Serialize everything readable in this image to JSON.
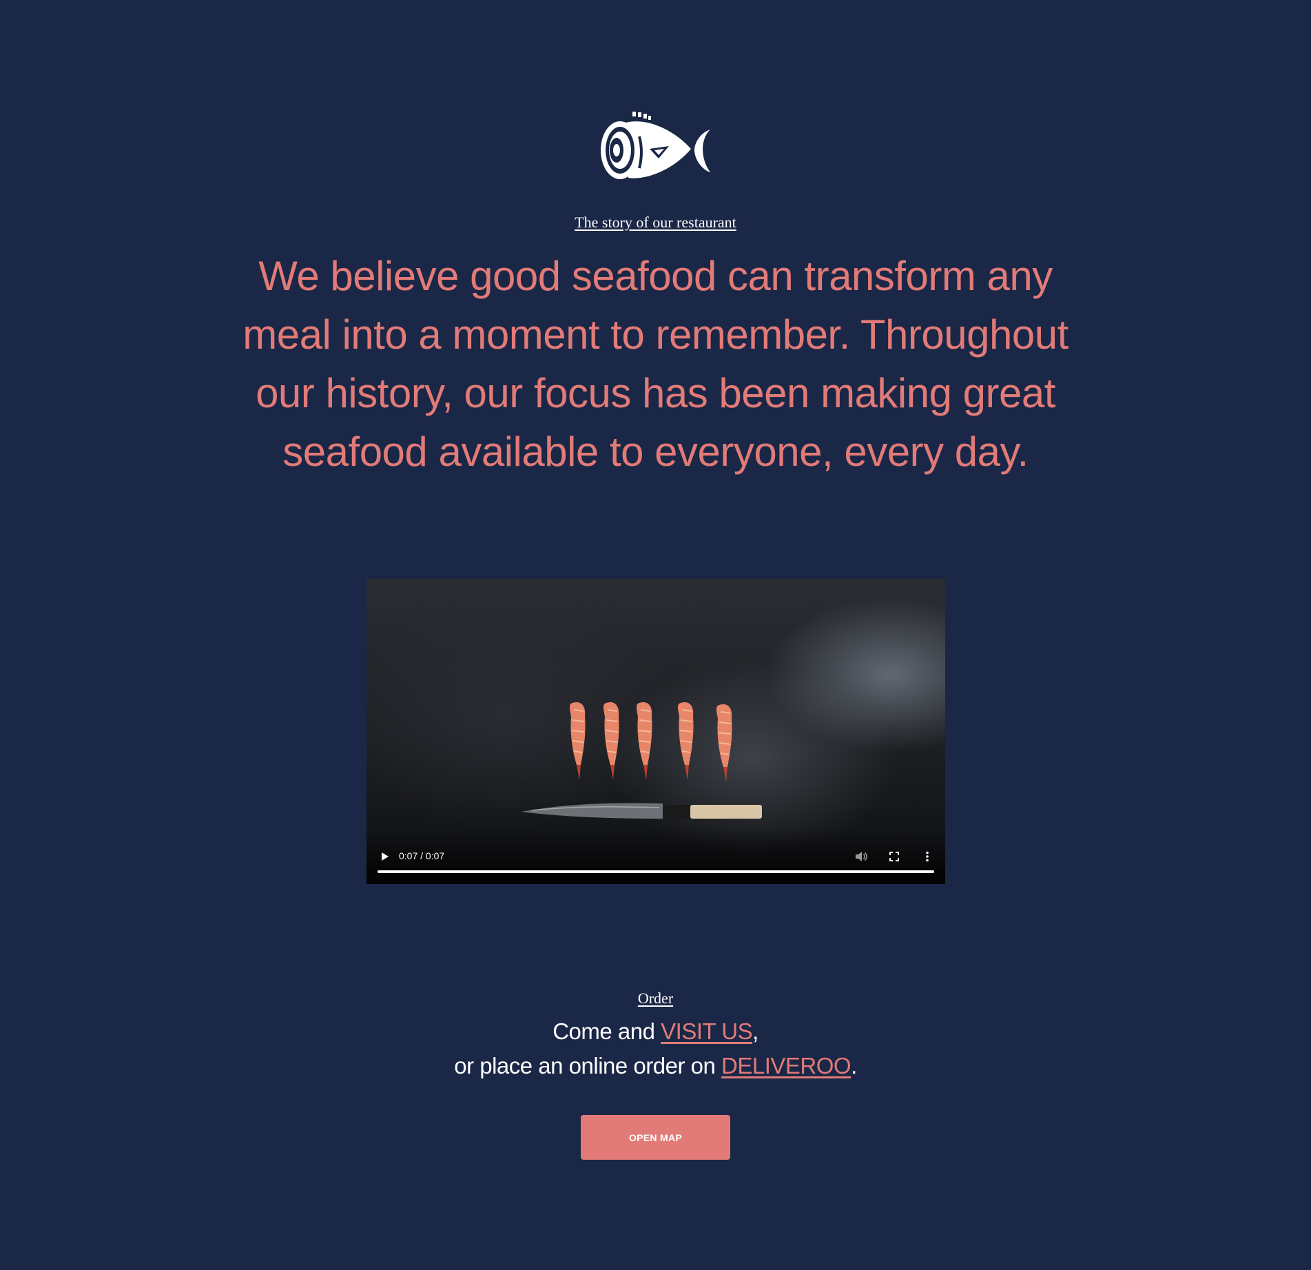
{
  "logo": {
    "icon": "fish-logo-icon"
  },
  "story": {
    "link_label": "The story of our restaurant"
  },
  "headline": "We believe good seafood can transform any meal into a moment to remember. Throughout our history, our focus has been making great seafood available to everyone, every day.",
  "video": {
    "time": "0:07 / 0:07",
    "progress": 1.0,
    "icons": [
      "play-icon",
      "volume-icon",
      "fullscreen-icon",
      "more-options-icon"
    ]
  },
  "order": {
    "label": "Order",
    "line1_prefix": "Come and ",
    "visit_link": "VISIT US",
    "line1_suffix": ",",
    "line2_prefix": "or place an online order on ",
    "deliveroo_link": "DELIVEROO",
    "line2_suffix": "."
  },
  "button": {
    "open_map": "OPEN MAP"
  },
  "colors": {
    "background": "#1b2746",
    "accent": "#e27b78",
    "text": "#ffffff"
  }
}
